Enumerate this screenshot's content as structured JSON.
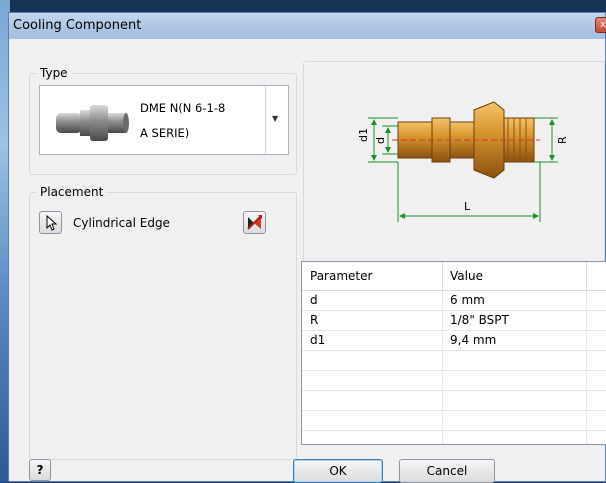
{
  "window": {
    "title": "Cooling Component",
    "close_glyph": "x"
  },
  "type_group": {
    "label": "Type",
    "selected": {
      "line1": "DME N(N 6-1-8",
      "line2": "A SERIE)"
    }
  },
  "placement_group": {
    "label": "Placement",
    "edge_label": "Cylindrical Edge"
  },
  "diagram": {
    "label_d1": "d1",
    "label_d": "d",
    "label_R": "R",
    "label_L": "L"
  },
  "parameters": {
    "headers": [
      "Parameter",
      "Value"
    ],
    "rows": [
      {
        "param": "d",
        "value": "6 mm"
      },
      {
        "param": "R",
        "value": "1/8\" BSPT"
      },
      {
        "param": "d1",
        "value": "9,4 mm"
      }
    ]
  },
  "buttons": {
    "help": "?",
    "ok": "OK",
    "cancel": "Cancel"
  }
}
